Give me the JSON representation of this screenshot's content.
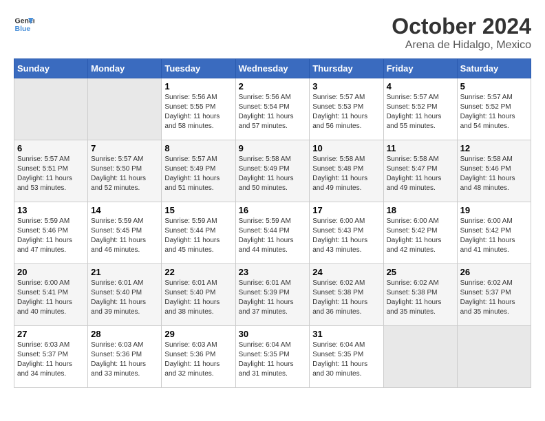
{
  "header": {
    "logo_line1": "General",
    "logo_line2": "Blue",
    "month": "October 2024",
    "location": "Arena de Hidalgo, Mexico"
  },
  "weekdays": [
    "Sunday",
    "Monday",
    "Tuesday",
    "Wednesday",
    "Thursday",
    "Friday",
    "Saturday"
  ],
  "weeks": [
    [
      {
        "day": "",
        "info": ""
      },
      {
        "day": "",
        "info": ""
      },
      {
        "day": "1",
        "info": "Sunrise: 5:56 AM\nSunset: 5:55 PM\nDaylight: 11 hours and 58 minutes."
      },
      {
        "day": "2",
        "info": "Sunrise: 5:56 AM\nSunset: 5:54 PM\nDaylight: 11 hours and 57 minutes."
      },
      {
        "day": "3",
        "info": "Sunrise: 5:57 AM\nSunset: 5:53 PM\nDaylight: 11 hours and 56 minutes."
      },
      {
        "day": "4",
        "info": "Sunrise: 5:57 AM\nSunset: 5:52 PM\nDaylight: 11 hours and 55 minutes."
      },
      {
        "day": "5",
        "info": "Sunrise: 5:57 AM\nSunset: 5:52 PM\nDaylight: 11 hours and 54 minutes."
      }
    ],
    [
      {
        "day": "6",
        "info": "Sunrise: 5:57 AM\nSunset: 5:51 PM\nDaylight: 11 hours and 53 minutes."
      },
      {
        "day": "7",
        "info": "Sunrise: 5:57 AM\nSunset: 5:50 PM\nDaylight: 11 hours and 52 minutes."
      },
      {
        "day": "8",
        "info": "Sunrise: 5:57 AM\nSunset: 5:49 PM\nDaylight: 11 hours and 51 minutes."
      },
      {
        "day": "9",
        "info": "Sunrise: 5:58 AM\nSunset: 5:49 PM\nDaylight: 11 hours and 50 minutes."
      },
      {
        "day": "10",
        "info": "Sunrise: 5:58 AM\nSunset: 5:48 PM\nDaylight: 11 hours and 49 minutes."
      },
      {
        "day": "11",
        "info": "Sunrise: 5:58 AM\nSunset: 5:47 PM\nDaylight: 11 hours and 49 minutes."
      },
      {
        "day": "12",
        "info": "Sunrise: 5:58 AM\nSunset: 5:46 PM\nDaylight: 11 hours and 48 minutes."
      }
    ],
    [
      {
        "day": "13",
        "info": "Sunrise: 5:59 AM\nSunset: 5:46 PM\nDaylight: 11 hours and 47 minutes."
      },
      {
        "day": "14",
        "info": "Sunrise: 5:59 AM\nSunset: 5:45 PM\nDaylight: 11 hours and 46 minutes."
      },
      {
        "day": "15",
        "info": "Sunrise: 5:59 AM\nSunset: 5:44 PM\nDaylight: 11 hours and 45 minutes."
      },
      {
        "day": "16",
        "info": "Sunrise: 5:59 AM\nSunset: 5:44 PM\nDaylight: 11 hours and 44 minutes."
      },
      {
        "day": "17",
        "info": "Sunrise: 6:00 AM\nSunset: 5:43 PM\nDaylight: 11 hours and 43 minutes."
      },
      {
        "day": "18",
        "info": "Sunrise: 6:00 AM\nSunset: 5:42 PM\nDaylight: 11 hours and 42 minutes."
      },
      {
        "day": "19",
        "info": "Sunrise: 6:00 AM\nSunset: 5:42 PM\nDaylight: 11 hours and 41 minutes."
      }
    ],
    [
      {
        "day": "20",
        "info": "Sunrise: 6:00 AM\nSunset: 5:41 PM\nDaylight: 11 hours and 40 minutes."
      },
      {
        "day": "21",
        "info": "Sunrise: 6:01 AM\nSunset: 5:40 PM\nDaylight: 11 hours and 39 minutes."
      },
      {
        "day": "22",
        "info": "Sunrise: 6:01 AM\nSunset: 5:40 PM\nDaylight: 11 hours and 38 minutes."
      },
      {
        "day": "23",
        "info": "Sunrise: 6:01 AM\nSunset: 5:39 PM\nDaylight: 11 hours and 37 minutes."
      },
      {
        "day": "24",
        "info": "Sunrise: 6:02 AM\nSunset: 5:38 PM\nDaylight: 11 hours and 36 minutes."
      },
      {
        "day": "25",
        "info": "Sunrise: 6:02 AM\nSunset: 5:38 PM\nDaylight: 11 hours and 35 minutes."
      },
      {
        "day": "26",
        "info": "Sunrise: 6:02 AM\nSunset: 5:37 PM\nDaylight: 11 hours and 35 minutes."
      }
    ],
    [
      {
        "day": "27",
        "info": "Sunrise: 6:03 AM\nSunset: 5:37 PM\nDaylight: 11 hours and 34 minutes."
      },
      {
        "day": "28",
        "info": "Sunrise: 6:03 AM\nSunset: 5:36 PM\nDaylight: 11 hours and 33 minutes."
      },
      {
        "day": "29",
        "info": "Sunrise: 6:03 AM\nSunset: 5:36 PM\nDaylight: 11 hours and 32 minutes."
      },
      {
        "day": "30",
        "info": "Sunrise: 6:04 AM\nSunset: 5:35 PM\nDaylight: 11 hours and 31 minutes."
      },
      {
        "day": "31",
        "info": "Sunrise: 6:04 AM\nSunset: 5:35 PM\nDaylight: 11 hours and 30 minutes."
      },
      {
        "day": "",
        "info": ""
      },
      {
        "day": "",
        "info": ""
      }
    ]
  ]
}
